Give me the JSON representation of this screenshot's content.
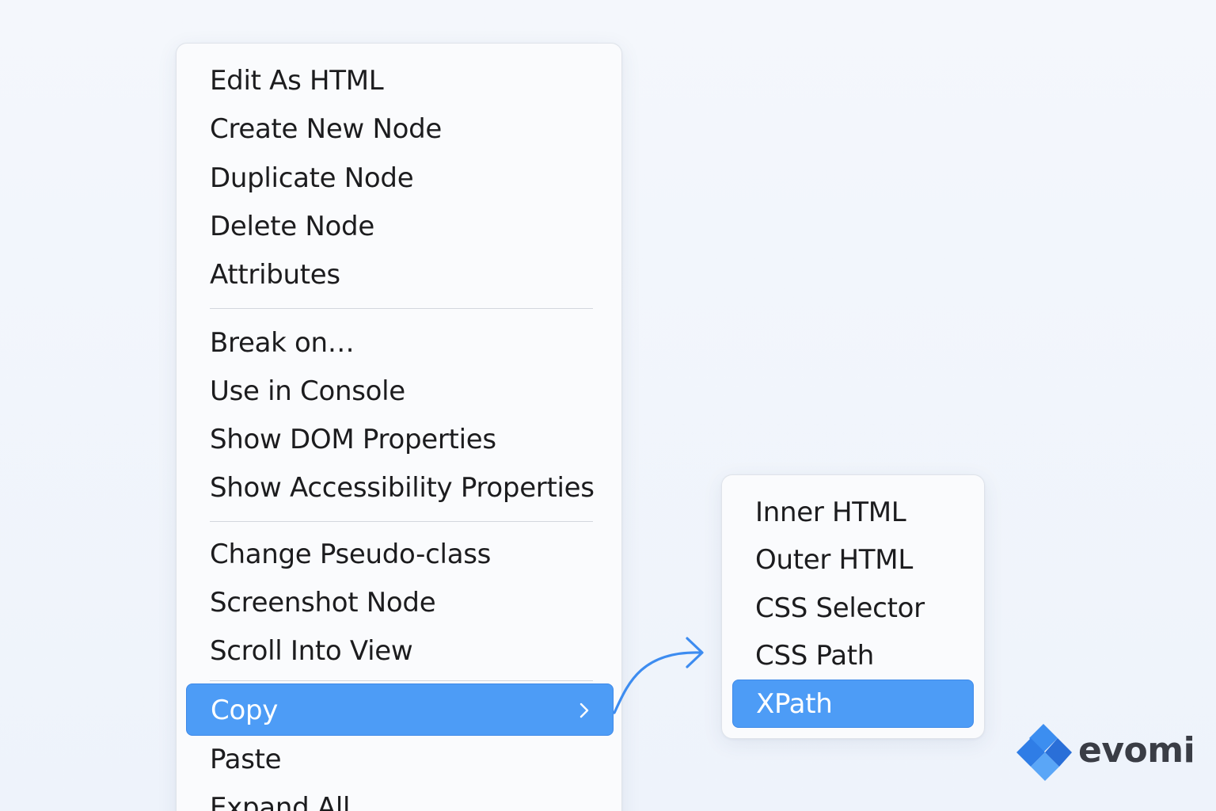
{
  "context_menu": {
    "groups": [
      [
        "Edit As HTML",
        "Create New Node",
        "Duplicate Node",
        "Delete Node",
        "Attributes"
      ],
      [
        "Break on…",
        "Use in Console",
        "Show DOM Properties",
        "Show Accessibility Properties"
      ],
      [
        "Change Pseudo-class",
        "Screenshot Node",
        "Scroll Into View"
      ]
    ],
    "copy_label": "Copy",
    "after_copy": [
      "Paste",
      "Expand All"
    ]
  },
  "copy_submenu": {
    "items": [
      "Inner HTML",
      "Outer HTML",
      "CSS Selector",
      "CSS Path"
    ],
    "selected": "XPath"
  },
  "brand": {
    "name": "evomi"
  },
  "icons": {
    "submenu_arrow": "chevron-right-icon",
    "connector": "curved-arrow-icon",
    "logo": "evomi-logo-icon"
  },
  "colors": {
    "highlight": "#4d9cf6",
    "arrow": "#3d8cf0",
    "background": "#f2f5fb"
  }
}
